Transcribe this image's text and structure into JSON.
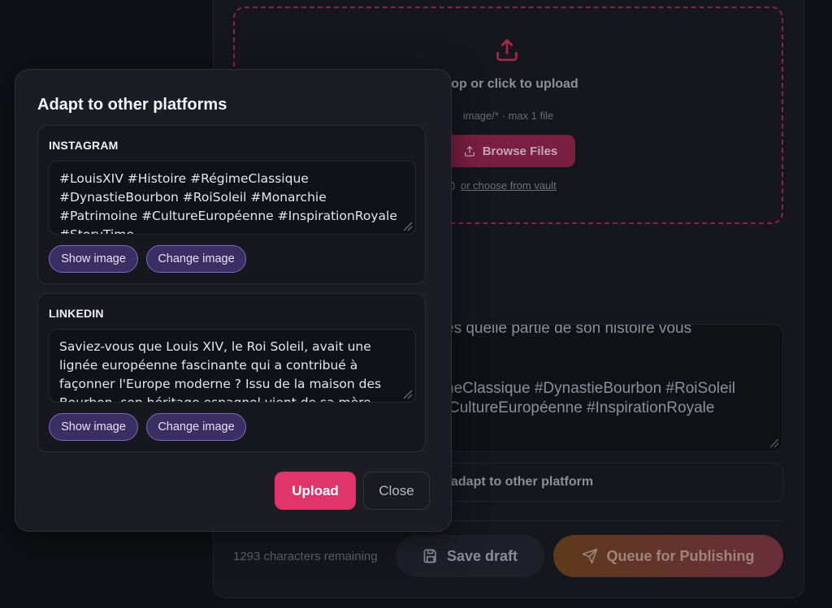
{
  "background": {
    "dropzone": {
      "title": "drop or click to upload",
      "hint": "image/* · max 1 file",
      "browse_label": "Browse Files",
      "vault_link": "or choose from vault"
    },
    "caption_lines": [
      "es quelle partie de son histoire vous",
      "neClassique #DynastieBourbon #RoiSoleil",
      "CultureEuropéenne #InspirationRoyale"
    ],
    "adapt_label": "adapt to other platform",
    "chars_remaining": "1293 characters remaining",
    "save_draft_label": "Save draft",
    "queue_label": "Queue for Publishing"
  },
  "modal": {
    "title": "Adapt to other platforms",
    "platforms": [
      {
        "name": "INSTAGRAM",
        "text": "#LouisXIV #Histoire #RégimeClassique #DynastieBourbon #RoiSoleil #Monarchie #Patrimoine #CultureEuropéenne #InspirationRoyale #StoryTime",
        "show_image_label": "Show image",
        "change_image_label": "Change image"
      },
      {
        "name": "LINKEDIN",
        "text": "Saviez-vous que Louis XIV, le Roi Soleil, avait une lignée européenne fascinante qui a contribué à façonner l'Europe moderne ? Issu de la maison des Bourbon, son héritage espagnol vient de sa mère Anne d'Autriche",
        "show_image_label": "Show image",
        "change_image_label": "Change image"
      }
    ],
    "upload_label": "Upload",
    "close_label": "Close"
  },
  "colors": {
    "accent": "#e0356b",
    "pill_bg": "#3a2f62",
    "pill_border": "#7c6bc0",
    "modal_bg": "#1c1d24"
  },
  "icons": [
    "upload-icon",
    "cloud-upload-icon",
    "vault-icon",
    "resize-grip-icon",
    "save-icon",
    "send-icon"
  ]
}
